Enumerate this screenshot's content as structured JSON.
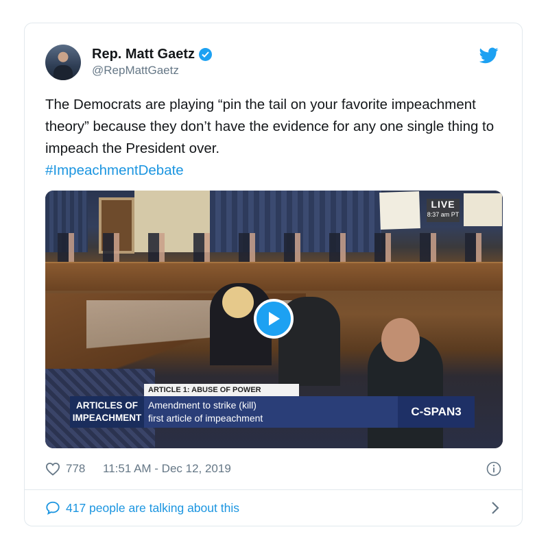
{
  "tweet": {
    "author_name": "Rep. Matt Gaetz",
    "handle": "@RepMattGaetz",
    "text": "The Democrats are playing “pin the tail on your favorite impeachment theory” because they don’t have the evidence for any one single thing to impeach the President over.",
    "hashtag": "#ImpeachmentDebate",
    "likes": "778",
    "timestamp": "11:51 AM - Dec 12, 2019",
    "talking": "417 people are talking about this"
  },
  "media": {
    "live_label": "LIVE",
    "live_time": "8:37 am PT",
    "chyron_top": "ARTICLE 1: ABUSE OF POWER",
    "chyron_left_1": "ARTICLES OF",
    "chyron_left_2": "IMPEACHMENT",
    "chyron_line_1": "Amendment to strike (kill)",
    "chyron_line_2": "first article of impeachment",
    "network": "C-SPAN3"
  },
  "colors": {
    "accent": "#1da1f2",
    "link": "#1b95e0",
    "muted": "#657786",
    "border": "#e1e8ed"
  },
  "icons": [
    "twitter-bird-icon",
    "verified-badge-icon",
    "play-icon",
    "heart-icon",
    "info-icon",
    "speech-bubble-icon",
    "chevron-right-icon"
  ]
}
